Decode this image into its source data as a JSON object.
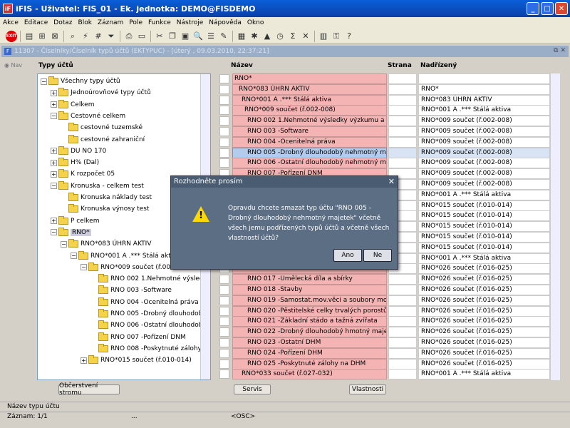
{
  "window": {
    "title": "iFIS - Uživatel: FIS_01 - Ek. jednotka: DEMO@FISDEMO",
    "app_icon": "iF"
  },
  "menu": [
    "Akce",
    "Editace",
    "Dotaz",
    "Blok",
    "Záznam",
    "Pole",
    "Funkce",
    "Nástroje",
    "Nápověda",
    "Okno"
  ],
  "toolbar": {
    "exit_label": "EXIT"
  },
  "inner_window": {
    "title": "11307 - Číselníky/Číselník typů účtů (EKTYPUC) - [úterý , 09.03.2010, 22:37:21]",
    "icon": "F"
  },
  "nav_label": "Nav",
  "tree": {
    "title": "Typy účtů",
    "refresh_button": "Občerstvení stromu",
    "nodes": [
      {
        "label": "Všechny typy účtů",
        "pm": "−"
      },
      {
        "label": "Jednoúrovňové typy účtů",
        "pm": "+"
      },
      {
        "label": "Celkem",
        "pm": "+"
      },
      {
        "label": "Cestovné celkem",
        "pm": "−"
      },
      {
        "label": "cestovné tuzemské",
        "pm": ""
      },
      {
        "label": "cestovné zahraniční",
        "pm": ""
      },
      {
        "label": "DU NO 170",
        "pm": "+"
      },
      {
        "label": "H% (Dal)",
        "pm": "+"
      },
      {
        "label": "K rozpočet 05",
        "pm": "+"
      },
      {
        "label": "Kronuska - celkem test",
        "pm": "−"
      },
      {
        "label": "Kronuska náklady test",
        "pm": ""
      },
      {
        "label": "Kronuska výnosy test",
        "pm": ""
      },
      {
        "label": "P celkem",
        "pm": "+"
      },
      {
        "label": "RNO*",
        "pm": "−"
      },
      {
        "label": "RNO*083 ÚHRN AKTIV",
        "pm": "−"
      },
      {
        "label": "RNO*001 A .*** Stálá aktiva",
        "pm": "−"
      },
      {
        "label": "RNO*009   součet (ř.002-008)",
        "pm": "−"
      },
      {
        "label": "RNO 002  1.Nehmotné výsledky výzkumu a vývoje",
        "pm": ""
      },
      {
        "label": "RNO 003    -Software",
        "pm": ""
      },
      {
        "label": "RNO 004    -Ocenitelná práva",
        "pm": ""
      },
      {
        "label": "RNO 005    -Drobný dlouhodobý nehmotný majetek",
        "pm": ""
      },
      {
        "label": "RNO 006    -Ostatní dlouhodobý nehmotný majetek",
        "pm": ""
      },
      {
        "label": "RNO 007    -Pořízení DNM",
        "pm": ""
      },
      {
        "label": "RNO 008    -Poskytnuté zálohy na DNM",
        "pm": ""
      },
      {
        "label": "RNO*015   součet (ř.010-014)",
        "pm": "+"
      }
    ]
  },
  "grid": {
    "headers": {
      "nazev": "Název",
      "strana": "Strana",
      "nadrizeny": "Nadřízený"
    },
    "rows": [
      {
        "nazev": "RNO*",
        "nadr": ""
      },
      {
        "nazev": "RNO*083 ÚHRN AKTIV",
        "nadr": "RNO*"
      },
      {
        "nazev": "RNO*001 A .*** Stálá aktiva",
        "nadr": "RNO*083 ÚHRN AKTIV"
      },
      {
        "nazev": "RNO*009   součet (ř.002-008)",
        "nadr": "RNO*001 A .*** Stálá aktiva"
      },
      {
        "nazev": "RNO 002  1.Nehmotné výsledky výzkumu a vývoje",
        "nadr": "RNO*009   součet (ř.002-008)"
      },
      {
        "nazev": "RNO 003    -Software",
        "nadr": "RNO*009   součet (ř.002-008)"
      },
      {
        "nazev": "RNO 004    -Ocenitelná práva",
        "nadr": "RNO*009   součet (ř.002-008)"
      },
      {
        "nazev": "RNO 005    -Drobný dlouhodobý nehmotný majetek",
        "nadr": "RNO*009   součet (ř.002-008)"
      },
      {
        "nazev": "RNO 006    -Ostatní dlouhodobý nehmotný majetek",
        "nadr": "RNO*009   součet (ř.002-008)"
      },
      {
        "nazev": "RNO 007    -Pořízení DNM",
        "nadr": "RNO*009   součet (ř.002-008)"
      },
      {
        "nazev": "",
        "nadr": "RNO*009   součet (ř.002-008)"
      },
      {
        "nazev": "",
        "nadr": "RNO*001 A .*** Stálá aktiva"
      },
      {
        "nazev": "",
        "nadr": "RNO*015   součet (ř.010-014)"
      },
      {
        "nazev": "",
        "nadr": "RNO*015   součet (ř.010-014)"
      },
      {
        "nazev": "",
        "nadr": "RNO*015   součet (ř.010-014)"
      },
      {
        "nazev": "",
        "nadr": "RNO*015   součet (ř.010-014)"
      },
      {
        "nazev": "",
        "nadr": "RNO*015   součet (ř.010-014)"
      },
      {
        "nazev": "",
        "nadr": "RNO*001 A .*** Stálá aktiva"
      },
      {
        "nazev": "",
        "nadr": "RNO*026   součet (ř.016-025)"
      },
      {
        "nazev": "RNO 017    -Umělecká díla a sbírky",
        "nadr": "RNO*026   součet (ř.016-025)"
      },
      {
        "nazev": "RNO 018    -Stavby",
        "nadr": "RNO*026   součet (ř.016-025)"
      },
      {
        "nazev": "RNO 019    -Samostat.mov.věci a soubory mov.věc",
        "nadr": "RNO*026   součet (ř.016-025)"
      },
      {
        "nazev": "RNO 020    -Pěstitelské celky trvalých porostů",
        "nadr": "RNO*026   součet (ř.016-025)"
      },
      {
        "nazev": "RNO 021    -Základní stádo a tažná zvířata",
        "nadr": "RNO*026   součet (ř.016-025)"
      },
      {
        "nazev": "RNO 022    -Drobný dlouhodobý hmotný majetek",
        "nadr": "RNO*026   součet (ř.016-025)"
      },
      {
        "nazev": "RNO 023    -Ostatní DHM",
        "nadr": "RNO*026   součet (ř.016-025)"
      },
      {
        "nazev": "RNO 024    -Pořízení DHM",
        "nadr": "RNO*026   součet (ř.016-025)"
      },
      {
        "nazev": "RNO 025    -Poskytnuté zálohy na DHM",
        "nadr": "RNO*026   součet (ř.016-025)"
      },
      {
        "nazev": "RNO*033   součet (ř.027-032)",
        "nadr": "RNO*001 A .*** Stálá aktiva"
      }
    ],
    "servis_button": "Servis",
    "vlastnosti_button": "Vlastnosti"
  },
  "dialog": {
    "title": "Rozhodněte prosím",
    "message": "Opravdu chcete smazat typ účtu \"RNO 005    -Drobný dlouhodobý nehmotný majetek\" včetně všech jemu podřízených typů účtů a včetně všech vlastností účtů?",
    "yes": "Ano",
    "no": "Ne"
  },
  "status": {
    "field_name": "Název typu účtu",
    "record": "Záznam: 1/1",
    "dots": "...",
    "osc": "<OSC>"
  }
}
